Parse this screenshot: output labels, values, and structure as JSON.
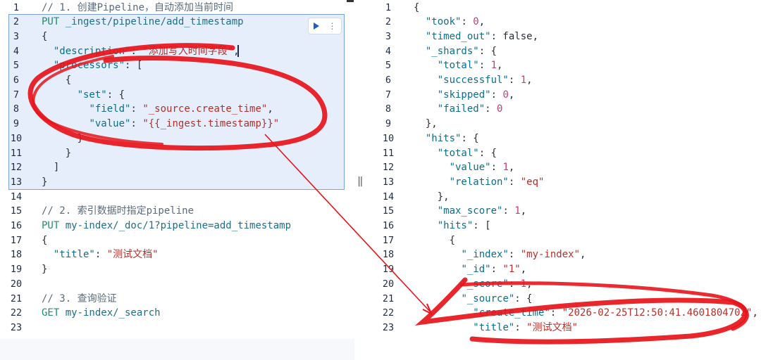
{
  "left": {
    "lines": [
      {
        "n": "1",
        "tokens": [
          {
            "t": "c",
            "v": "// 1. 创建Pipeline，自动添加当前时间"
          }
        ]
      },
      {
        "n": "2",
        "tokens": [
          {
            "t": "m",
            "v": "PUT "
          },
          {
            "t": "u",
            "v": "_ingest/pipeline/add_timestamp"
          }
        ]
      },
      {
        "n": "3",
        "tokens": [
          {
            "t": "p",
            "v": "{"
          }
        ]
      },
      {
        "n": "4",
        "tokens": [
          {
            "t": "p",
            "v": "  "
          },
          {
            "t": "k",
            "v": "\"description\""
          },
          {
            "t": "p",
            "v": ": "
          },
          {
            "t": "s",
            "v": "\"添加写入时间字段\""
          },
          {
            "t": "p",
            "v": ","
          }
        ]
      },
      {
        "n": "5",
        "tokens": [
          {
            "t": "p",
            "v": "  "
          },
          {
            "t": "k",
            "v": "\"processors\""
          },
          {
            "t": "p",
            "v": ": ["
          }
        ]
      },
      {
        "n": "6",
        "tokens": [
          {
            "t": "p",
            "v": "    {"
          }
        ]
      },
      {
        "n": "7",
        "tokens": [
          {
            "t": "p",
            "v": "      "
          },
          {
            "t": "k",
            "v": "\"set\""
          },
          {
            "t": "p",
            "v": ": {"
          }
        ]
      },
      {
        "n": "8",
        "tokens": [
          {
            "t": "p",
            "v": "        "
          },
          {
            "t": "k",
            "v": "\"field\""
          },
          {
            "t": "p",
            "v": ": "
          },
          {
            "t": "s",
            "v": "\"_source.create_time\""
          },
          {
            "t": "p",
            "v": ","
          }
        ]
      },
      {
        "n": "9",
        "tokens": [
          {
            "t": "p",
            "v": "        "
          },
          {
            "t": "k",
            "v": "\"value\""
          },
          {
            "t": "p",
            "v": ": "
          },
          {
            "t": "s",
            "v": "\"{{_ingest.timestamp}}\""
          }
        ]
      },
      {
        "n": "10",
        "tokens": [
          {
            "t": "p",
            "v": "      }"
          }
        ]
      },
      {
        "n": "11",
        "tokens": [
          {
            "t": "p",
            "v": "    }"
          }
        ]
      },
      {
        "n": "12",
        "tokens": [
          {
            "t": "p",
            "v": "  ]"
          }
        ]
      },
      {
        "n": "13",
        "tokens": [
          {
            "t": "p",
            "v": "}"
          }
        ]
      },
      {
        "n": "14",
        "tokens": []
      },
      {
        "n": "15",
        "tokens": [
          {
            "t": "c",
            "v": "// 2. 索引数据时指定pipeline"
          }
        ]
      },
      {
        "n": "16",
        "tokens": [
          {
            "t": "m",
            "v": "PUT "
          },
          {
            "t": "u",
            "v": "my-index/_doc/1?pipeline=add_timestamp"
          }
        ]
      },
      {
        "n": "17",
        "tokens": [
          {
            "t": "p",
            "v": "{"
          }
        ]
      },
      {
        "n": "18",
        "tokens": [
          {
            "t": "p",
            "v": "  "
          },
          {
            "t": "k",
            "v": "\"title\""
          },
          {
            "t": "p",
            "v": ": "
          },
          {
            "t": "s",
            "v": "\"测试文档\""
          }
        ]
      },
      {
        "n": "19",
        "tokens": [
          {
            "t": "p",
            "v": "}"
          }
        ]
      },
      {
        "n": "20",
        "tokens": []
      },
      {
        "n": "21",
        "tokens": [
          {
            "t": "c",
            "v": "// 3. 查询验证"
          }
        ]
      },
      {
        "n": "22",
        "tokens": [
          {
            "t": "m",
            "v": "GET "
          },
          {
            "t": "u",
            "v": "my-index/_search"
          }
        ]
      },
      {
        "n": "23",
        "tokens": []
      }
    ]
  },
  "right": {
    "lines": [
      {
        "n": "1",
        "tokens": [
          {
            "t": "p",
            "v": "{"
          }
        ]
      },
      {
        "n": "2",
        "tokens": [
          {
            "t": "p",
            "v": "  "
          },
          {
            "t": "k",
            "v": "\"took\""
          },
          {
            "t": "p",
            "v": ": "
          },
          {
            "t": "n",
            "v": "0"
          },
          {
            "t": "p",
            "v": ","
          }
        ]
      },
      {
        "n": "3",
        "tokens": [
          {
            "t": "p",
            "v": "  "
          },
          {
            "t": "k",
            "v": "\"timed_out\""
          },
          {
            "t": "p",
            "v": ": false,"
          }
        ]
      },
      {
        "n": "4",
        "tokens": [
          {
            "t": "p",
            "v": "  "
          },
          {
            "t": "k",
            "v": "\"_shards\""
          },
          {
            "t": "p",
            "v": ": {"
          }
        ]
      },
      {
        "n": "5",
        "tokens": [
          {
            "t": "p",
            "v": "    "
          },
          {
            "t": "k",
            "v": "\"total\""
          },
          {
            "t": "p",
            "v": ": "
          },
          {
            "t": "n",
            "v": "1"
          },
          {
            "t": "p",
            "v": ","
          }
        ]
      },
      {
        "n": "6",
        "tokens": [
          {
            "t": "p",
            "v": "    "
          },
          {
            "t": "k",
            "v": "\"successful\""
          },
          {
            "t": "p",
            "v": ": "
          },
          {
            "t": "n",
            "v": "1"
          },
          {
            "t": "p",
            "v": ","
          }
        ]
      },
      {
        "n": "7",
        "tokens": [
          {
            "t": "p",
            "v": "    "
          },
          {
            "t": "k",
            "v": "\"skipped\""
          },
          {
            "t": "p",
            "v": ": "
          },
          {
            "t": "n",
            "v": "0"
          },
          {
            "t": "p",
            "v": ","
          }
        ]
      },
      {
        "n": "8",
        "tokens": [
          {
            "t": "p",
            "v": "    "
          },
          {
            "t": "k",
            "v": "\"failed\""
          },
          {
            "t": "p",
            "v": ": "
          },
          {
            "t": "n",
            "v": "0"
          }
        ]
      },
      {
        "n": "9",
        "tokens": [
          {
            "t": "p",
            "v": "  },"
          }
        ]
      },
      {
        "n": "10",
        "tokens": [
          {
            "t": "p",
            "v": "  "
          },
          {
            "t": "k",
            "v": "\"hits\""
          },
          {
            "t": "p",
            "v": ": {"
          }
        ]
      },
      {
        "n": "11",
        "tokens": [
          {
            "t": "p",
            "v": "    "
          },
          {
            "t": "k",
            "v": "\"total\""
          },
          {
            "t": "p",
            "v": ": {"
          }
        ]
      },
      {
        "n": "12",
        "tokens": [
          {
            "t": "p",
            "v": "      "
          },
          {
            "t": "k",
            "v": "\"value\""
          },
          {
            "t": "p",
            "v": ": "
          },
          {
            "t": "n",
            "v": "1"
          },
          {
            "t": "p",
            "v": ","
          }
        ]
      },
      {
        "n": "13",
        "tokens": [
          {
            "t": "p",
            "v": "      "
          },
          {
            "t": "k",
            "v": "\"relation\""
          },
          {
            "t": "p",
            "v": ": "
          },
          {
            "t": "s",
            "v": "\"eq\""
          }
        ]
      },
      {
        "n": "14",
        "tokens": [
          {
            "t": "p",
            "v": "    },"
          }
        ]
      },
      {
        "n": "15",
        "tokens": [
          {
            "t": "p",
            "v": "    "
          },
          {
            "t": "k",
            "v": "\"max_score\""
          },
          {
            "t": "p",
            "v": ": "
          },
          {
            "t": "n",
            "v": "1"
          },
          {
            "t": "p",
            "v": ","
          }
        ]
      },
      {
        "n": "16",
        "tokens": [
          {
            "t": "p",
            "v": "    "
          },
          {
            "t": "k",
            "v": "\"hits\""
          },
          {
            "t": "p",
            "v": ": ["
          }
        ]
      },
      {
        "n": "17",
        "tokens": [
          {
            "t": "p",
            "v": "      {"
          }
        ]
      },
      {
        "n": "18",
        "tokens": [
          {
            "t": "p",
            "v": "        "
          },
          {
            "t": "k",
            "v": "\"_index\""
          },
          {
            "t": "p",
            "v": ": "
          },
          {
            "t": "s",
            "v": "\"my-index\""
          },
          {
            "t": "p",
            "v": ","
          }
        ]
      },
      {
        "n": "19",
        "tokens": [
          {
            "t": "p",
            "v": "        "
          },
          {
            "t": "k",
            "v": "\"_id\""
          },
          {
            "t": "p",
            "v": ": "
          },
          {
            "t": "s",
            "v": "\"1\""
          },
          {
            "t": "p",
            "v": ","
          }
        ]
      },
      {
        "n": "20",
        "tokens": [
          {
            "t": "p",
            "v": "        "
          },
          {
            "t": "k",
            "v": "\"_score\""
          },
          {
            "t": "p",
            "v": ": "
          },
          {
            "t": "n",
            "v": "1"
          },
          {
            "t": "p",
            "v": ","
          }
        ]
      },
      {
        "n": "21",
        "tokens": [
          {
            "t": "p",
            "v": "        "
          },
          {
            "t": "k",
            "v": "\"_source\""
          },
          {
            "t": "p",
            "v": ": {"
          }
        ]
      },
      {
        "n": "22",
        "tokens": [
          {
            "t": "p",
            "v": "          "
          },
          {
            "t": "k",
            "v": "\"create_time\""
          },
          {
            "t": "p",
            "v": ": "
          },
          {
            "t": "s",
            "v": "\"2026-02-25T12:50:41.460180470Z\""
          },
          {
            "t": "p",
            "v": ","
          }
        ]
      },
      {
        "n": "23",
        "tokens": [
          {
            "t": "p",
            "v": "          "
          },
          {
            "t": "k",
            "v": "\"title\""
          },
          {
            "t": "p",
            "v": ": "
          },
          {
            "t": "s",
            "v": "\"测试文档\""
          }
        ]
      }
    ]
  },
  "colors": {
    "key": "#0b6f8a",
    "string": "#b5302a",
    "number": "#c73a7a",
    "comment": "#5b6b7c",
    "method": "#1f8f6a",
    "url": "#1f6f8a",
    "selection": "#e5eefa",
    "annotation": "#e8141b"
  },
  "icons": {
    "run": "play-triangle-icon",
    "menu": "vertical-dots-icon",
    "resize": "drag-handle-icon"
  }
}
